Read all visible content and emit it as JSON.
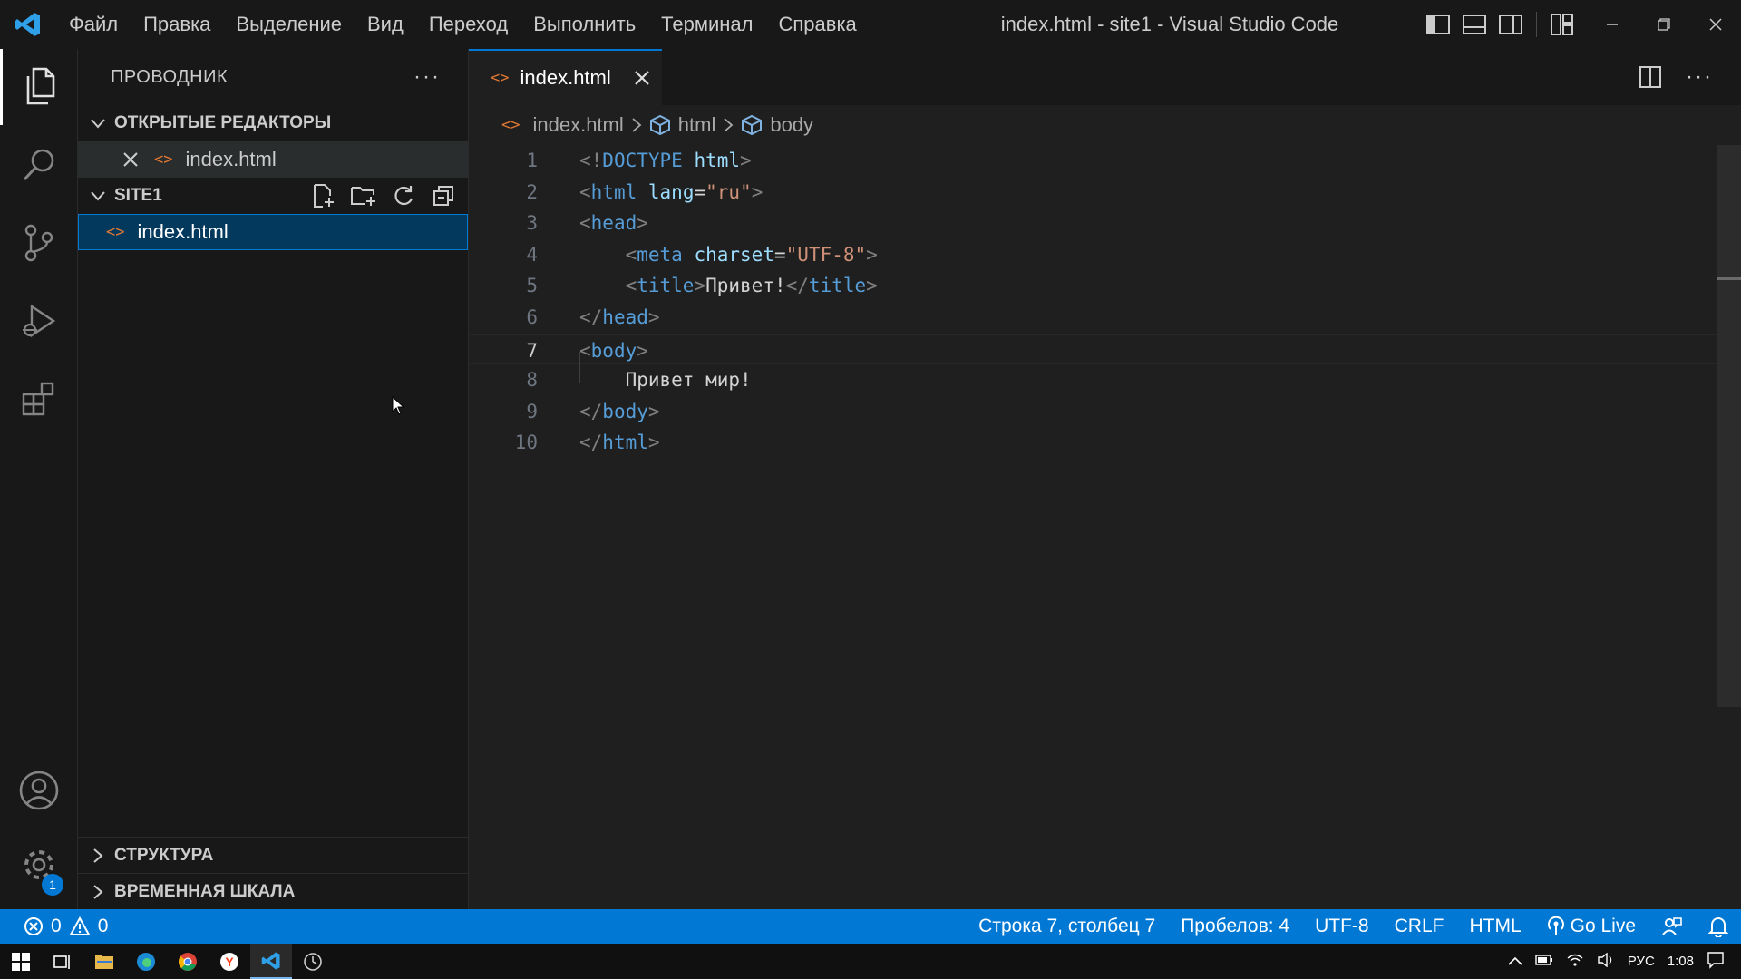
{
  "titlebar": {
    "menu": [
      "Файл",
      "Правка",
      "Выделение",
      "Вид",
      "Переход",
      "Выполнить",
      "Терминал",
      "Справка"
    ],
    "window_title": "index.html - site1 - Visual Studio Code"
  },
  "activitybar": {
    "items": [
      "explorer-icon",
      "search-icon",
      "source-control-icon",
      "run-debug-icon",
      "extensions-icon"
    ],
    "bottom": [
      "account-icon",
      "gear-icon"
    ],
    "settings_badge": "1"
  },
  "sidebar": {
    "title": "ПРОВОДНИК",
    "more": "···",
    "open_editors_label": "ОТКРЫТЫЕ РЕДАКТОРЫ",
    "open_editor_file": "index.html",
    "folder_label": "SITE1",
    "files": [
      "index.html"
    ],
    "outline_label": "СТРУКТУРА",
    "timeline_label": "ВРЕМЕННАЯ ШКАЛА"
  },
  "editor": {
    "tab_label": "index.html",
    "more": "···",
    "breadcrumbs": [
      "index.html",
      "html",
      "body"
    ],
    "current_line": 7,
    "lines": [
      {
        "n": "1",
        "tokens": [
          [
            "br",
            "<!"
          ],
          [
            "tag",
            "DOCTYPE"
          ],
          [
            "txt",
            " "
          ],
          [
            "attr",
            "html"
          ],
          [
            "br",
            ">"
          ]
        ]
      },
      {
        "n": "2",
        "tokens": [
          [
            "br",
            "<"
          ],
          [
            "tag",
            "html"
          ],
          [
            "txt",
            " "
          ],
          [
            "attr",
            "lang"
          ],
          [
            "txt",
            "="
          ],
          [
            "str",
            "\"ru\""
          ],
          [
            "br",
            ">"
          ]
        ]
      },
      {
        "n": "3",
        "tokens": [
          [
            "br",
            "<"
          ],
          [
            "tag",
            "head"
          ],
          [
            "br",
            ">"
          ]
        ]
      },
      {
        "n": "4",
        "tokens": [
          [
            "txt",
            "    "
          ],
          [
            "br",
            "<"
          ],
          [
            "tag",
            "meta"
          ],
          [
            "txt",
            " "
          ],
          [
            "attr",
            "charset"
          ],
          [
            "txt",
            "="
          ],
          [
            "str",
            "\"UTF-8\""
          ],
          [
            "br",
            ">"
          ]
        ]
      },
      {
        "n": "5",
        "tokens": [
          [
            "txt",
            "    "
          ],
          [
            "br",
            "<"
          ],
          [
            "tag",
            "title"
          ],
          [
            "br",
            ">"
          ],
          [
            "txt",
            "Привет!"
          ],
          [
            "br",
            "</"
          ],
          [
            "tag",
            "title"
          ],
          [
            "br",
            ">"
          ]
        ]
      },
      {
        "n": "6",
        "tokens": [
          [
            "br",
            "</"
          ],
          [
            "tag",
            "head"
          ],
          [
            "br",
            ">"
          ]
        ]
      },
      {
        "n": "7",
        "tokens": [
          [
            "br",
            "<"
          ],
          [
            "tag",
            "body"
          ],
          [
            "br",
            ">"
          ]
        ]
      },
      {
        "n": "8",
        "tokens": [
          [
            "txt",
            "    Привет мир!"
          ]
        ]
      },
      {
        "n": "9",
        "tokens": [
          [
            "br",
            "</"
          ],
          [
            "tag",
            "body"
          ],
          [
            "br",
            ">"
          ]
        ]
      },
      {
        "n": "10",
        "tokens": [
          [
            "br",
            "</"
          ],
          [
            "tag",
            "html"
          ],
          [
            "br",
            ">"
          ]
        ]
      }
    ]
  },
  "statusbar": {
    "errors": "0",
    "warnings": "0",
    "position": "Строка 7, столбец 7",
    "spaces": "Пробелов: 4",
    "encoding": "UTF-8",
    "eol": "CRLF",
    "language": "HTML",
    "go_live": "Go Live"
  },
  "taskbar": {
    "lang": "РУС",
    "time": "1:08"
  },
  "colors": {
    "accent": "#0078d4",
    "background": "#1f1f1f",
    "sidebar": "#181818",
    "html_icon": "#e37933"
  }
}
